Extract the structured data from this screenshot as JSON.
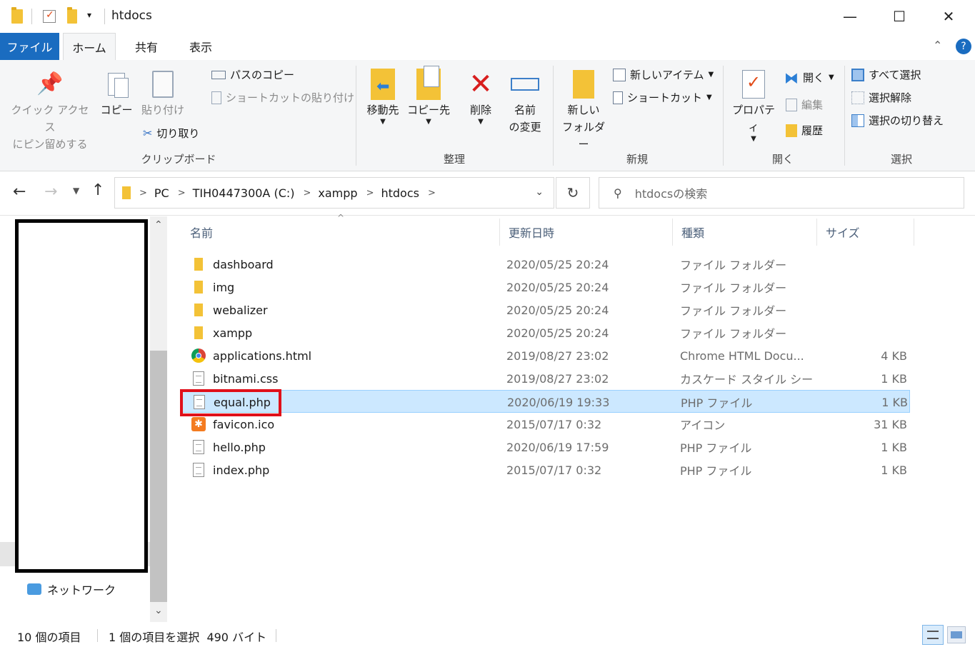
{
  "window": {
    "title": "htdocs",
    "min_glyph": "—",
    "max_glyph": "☐",
    "close_glyph": "✕"
  },
  "tabs": {
    "file": "ファイル",
    "home": "ホーム",
    "share": "共有",
    "view": "表示"
  },
  "ribbon": {
    "clipboard": {
      "pin_label_1": "クイック アクセス",
      "pin_label_2": "にピン留めする",
      "copy": "コピー",
      "paste": "貼り付け",
      "copy_path": "パスのコピー",
      "paste_shortcut": "ショートカットの貼り付け",
      "cut": "切り取り",
      "group": "クリップボード"
    },
    "organize": {
      "move_to": "移動先",
      "copy_to": "コピー先",
      "delete": "削除",
      "rename_1": "名前",
      "rename_2": "の変更",
      "group": "整理"
    },
    "new": {
      "new_folder_1": "新しい",
      "new_folder_2": "フォルダー",
      "new_item": "新しいアイテム",
      "shortcut": "ショートカット",
      "group": "新規"
    },
    "open": {
      "properties": "プロパティ",
      "open": "開く",
      "edit": "編集",
      "history": "履歴",
      "group": "開く"
    },
    "select": {
      "select_all": "すべて選択",
      "select_none": "選択解除",
      "invert": "選択の切り替え",
      "group": "選択"
    }
  },
  "address": {
    "crumbs": [
      "PC",
      "TIH0447300A (C:)",
      "xampp",
      "htdocs"
    ],
    "search_placeholder": "htdocsの検索"
  },
  "navpane": {
    "network": "ネットワーク"
  },
  "columns": {
    "name": "名前",
    "date": "更新日時",
    "type": "種類",
    "size": "サイズ"
  },
  "files": [
    {
      "name": "dashboard",
      "date": "2020/05/25 20:24",
      "type": "ファイル フォルダー",
      "size": "",
      "icon": "folder-icon"
    },
    {
      "name": "img",
      "date": "2020/05/25 20:24",
      "type": "ファイル フォルダー",
      "size": "",
      "icon": "folder-icon"
    },
    {
      "name": "webalizer",
      "date": "2020/05/25 20:24",
      "type": "ファイル フォルダー",
      "size": "",
      "icon": "folder-icon"
    },
    {
      "name": "xampp",
      "date": "2020/05/25 20:24",
      "type": "ファイル フォルダー",
      "size": "",
      "icon": "folder-icon"
    },
    {
      "name": "applications.html",
      "date": "2019/08/27 23:02",
      "type": "Chrome HTML Docu...",
      "size": "4 KB",
      "icon": "chrome-icon"
    },
    {
      "name": "bitnami.css",
      "date": "2019/08/27 23:02",
      "type": "カスケード スタイル シート...",
      "size": "1 KB",
      "icon": "css-file-icon"
    },
    {
      "name": "equal.php",
      "date": "2020/06/19 19:33",
      "type": "PHP ファイル",
      "size": "1 KB",
      "icon": "php-file-icon"
    },
    {
      "name": "favicon.ico",
      "date": "2015/07/17 0:32",
      "type": "アイコン",
      "size": "31 KB",
      "icon": "xampp-icon"
    },
    {
      "name": "hello.php",
      "date": "2020/06/19 17:59",
      "type": "PHP ファイル",
      "size": "1 KB",
      "icon": "php-file-icon"
    },
    {
      "name": "index.php",
      "date": "2015/07/17 0:32",
      "type": "PHP ファイル",
      "size": "1 KB",
      "icon": "php-file-icon"
    }
  ],
  "status": {
    "count": "10 個の項目",
    "selection": "1 個の項目を選択  490 バイト"
  },
  "colors": {
    "accent": "#1a6cc0",
    "selection": "#cce8ff",
    "highlight_box": "#e0101a"
  }
}
